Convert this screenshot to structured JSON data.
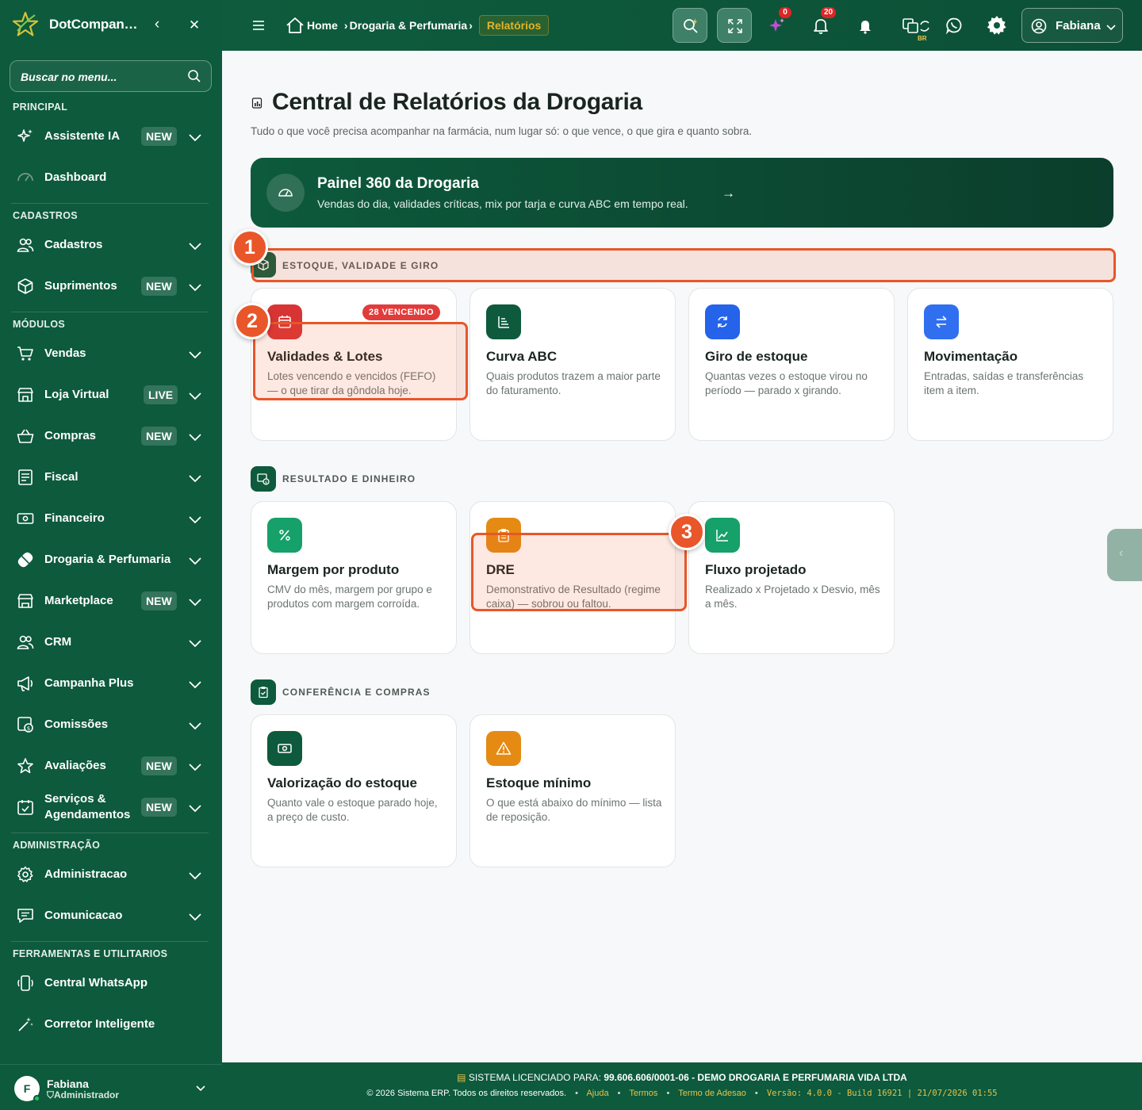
{
  "app": {
    "title": "DotCompan…"
  },
  "sidebar": {
    "search_placeholder": "Buscar no menu...",
    "sections": {
      "principal": "PRINCIPAL",
      "cadastros": "CADASTROS",
      "modulos": "MÓDULOS",
      "administracao": "ADMINISTRAÇÃO",
      "ferramentas": "FERRAMENTAS E UTILITARIOS"
    },
    "items": [
      {
        "label": "Assistente IA",
        "badge": "NEW",
        "icon": "sparkles-icon"
      },
      {
        "label": "Dashboard",
        "badge": "",
        "icon": "gauge-icon"
      },
      {
        "label": "Cadastros",
        "badge": "",
        "icon": "users-icon"
      },
      {
        "label": "Suprimentos",
        "badge": "NEW",
        "icon": "box-icon"
      },
      {
        "label": "Vendas",
        "badge": "",
        "icon": "cart-icon"
      },
      {
        "label": "Loja Virtual",
        "badge": "LIVE",
        "icon": "store-icon"
      },
      {
        "label": "Compras",
        "badge": "NEW",
        "icon": "basket-icon"
      },
      {
        "label": "Fiscal",
        "badge": "",
        "icon": "receipt-icon"
      },
      {
        "label": "Financeiro",
        "badge": "",
        "icon": "cash-icon"
      },
      {
        "label": "Drogaria & Perfumaria",
        "badge": "",
        "icon": "pill-icon"
      },
      {
        "label": "Marketplace",
        "badge": "NEW",
        "icon": "marketplace-icon"
      },
      {
        "label": "CRM",
        "badge": "",
        "icon": "crm-users-icon"
      },
      {
        "label": "Campanha Plus",
        "badge": "",
        "icon": "megaphone-icon"
      },
      {
        "label": "Comissões",
        "badge": "",
        "icon": "commission-icon"
      },
      {
        "label": "Avaliações",
        "badge": "NEW",
        "icon": "star-icon"
      },
      {
        "label": "Serviços & Agendamentos",
        "badge": "NEW",
        "icon": "calendar-check-icon"
      },
      {
        "label": "Administracao",
        "badge": "",
        "icon": "gear-icon"
      },
      {
        "label": "Comunicacao",
        "badge": "",
        "icon": "message-icon"
      },
      {
        "label": "Central WhatsApp",
        "badge": "",
        "icon": "phone-icon"
      },
      {
        "label": "Corretor Inteligente",
        "badge": "",
        "icon": "wand-icon"
      }
    ],
    "user": {
      "initial": "F",
      "name": "Fabiana",
      "role": "Administrador"
    }
  },
  "topbar": {
    "breadcrumb": {
      "home": "Home",
      "section": "Drogaria & Perfumaria",
      "current": "Relatórios"
    },
    "ai_count": "0",
    "notifications_count": "20",
    "lang_tag": "BR",
    "user_name": "Fabiana"
  },
  "page": {
    "title": "Central de Relatórios da Drogaria",
    "subtitle": "Tudo o que você precisa acompanhar na farmácia, num lugar só: o que vence, o que gira e quanto sobra.",
    "banner": {
      "title": "Painel 360 da Drogaria",
      "desc": "Vendas do dia, validades críticas, mix por tarja e curva ABC em tempo real."
    },
    "sections": [
      {
        "label": "ESTOQUE, VALIDADE E GIRO",
        "cards": [
          {
            "title": "Validades & Lotes",
            "desc": "Lotes vencendo e vencidos (FEFO) — o que tirar da gôndola hoje.",
            "badge": "28 VENCENDO",
            "icon": "calendar-icon",
            "color": "#d93434"
          },
          {
            "title": "Curva ABC",
            "desc": "Quais produtos trazem a maior parte do faturamento.",
            "badge": "",
            "icon": "list-sort-icon",
            "color": "#0d5a3c"
          },
          {
            "title": "Giro de estoque",
            "desc": "Quantas vezes o estoque virou no período — parado x girando.",
            "badge": "",
            "icon": "refresh-icon",
            "color": "#2563eb"
          },
          {
            "title": "Movimentação",
            "desc": "Entradas, saídas e transferências item a item.",
            "badge": "",
            "icon": "arrows-icon",
            "color": "#2f6ff0"
          }
        ]
      },
      {
        "label": "RESULTADO E DINHEIRO",
        "cards": [
          {
            "title": "Margem por produto",
            "desc": "CMV do mês, margem por grupo e produtos com margem corroída.",
            "badge": "",
            "icon": "percent-icon",
            "color": "#16a06a"
          },
          {
            "title": "DRE",
            "desc": "Demonstrativo de Resultado (regime caixa) — sobrou ou faltou.",
            "badge": "",
            "icon": "clipboard-icon",
            "color": "#e58a12"
          },
          {
            "title": "Fluxo projetado",
            "desc": "Realizado x Projetado x Desvio, mês a mês.",
            "badge": "",
            "icon": "chart-up-icon",
            "color": "#16a06a"
          }
        ]
      },
      {
        "label": "CONFERÊNCIA E COMPRAS",
        "cards": [
          {
            "title": "Valorização do estoque",
            "desc": "Quanto vale o estoque parado hoje, a preço de custo.",
            "badge": "",
            "icon": "money-icon",
            "color": "#0d5a3c"
          },
          {
            "title": "Estoque mínimo",
            "desc": "O que está abaixo do mínimo — lista de reposição.",
            "badge": "",
            "icon": "warning-icon",
            "color": "#e58a12"
          }
        ]
      }
    ]
  },
  "annotations": [
    "1",
    "2",
    "3"
  ],
  "footer": {
    "license_label": "SISTEMA LICENCIADO PARA:",
    "license_value": "99.606.606/0001-06 - DEMO DROGARIA E PERFUMARIA VIDA LTDA",
    "copyright": "© 2026 Sistema ERP. Todos os direitos reservados.",
    "links": [
      "Ajuda",
      "Termos",
      "Termo de Adesao"
    ],
    "version": "Versão: 4.0.0 - Build 16921 | 21/07/2026 01:55"
  }
}
